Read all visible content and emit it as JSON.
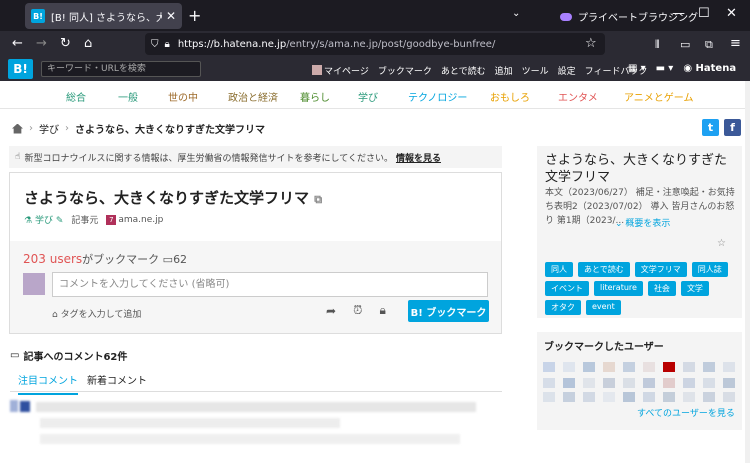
{
  "browser": {
    "tab_title": "[B! 同人] さようなら、大きくなりすぎ",
    "private_label": "プライベートブラウジング",
    "url_host": "https://b.hatena.ne.jp",
    "url_path": "/entry/s/ama.ne.jp/post/goodbye-bunfree/"
  },
  "header": {
    "logo": "B!",
    "search_placeholder": "キーワード・URLを検索",
    "menu": [
      "マイページ",
      "ブックマーク",
      "あとで読む",
      "追加",
      "ツール",
      "設定",
      "フィードバック"
    ],
    "brand": "Hatena"
  },
  "categories": [
    {
      "label": "総合",
      "color": "#2a9a7b"
    },
    {
      "label": "一般",
      "color": "#2a9a7b"
    },
    {
      "label": "世の中",
      "color": "#9d6a2a"
    },
    {
      "label": "政治と経済",
      "color": "#8a6d2e"
    },
    {
      "label": "暮らし",
      "color": "#4a8a2a"
    },
    {
      "label": "学び",
      "color": "#2a9a7b"
    },
    {
      "label": "テクノロジー",
      "color": "#00a4de"
    },
    {
      "label": "おもしろ",
      "color": "#e8a000"
    },
    {
      "label": "エンタメ",
      "color": "#e05454"
    },
    {
      "label": "アニメとゲーム",
      "color": "#e8a000"
    }
  ],
  "breadcrumb": {
    "category": "学び",
    "current": "さようなら、大きくなりすぎた文学フリマ"
  },
  "notice": {
    "text": "新型コロナウイルスに関する情報は、厚生労働省の情報発信サイトを参考にしてください。",
    "link": "情報を見る"
  },
  "entry": {
    "title": "さようなら、大きくなりすぎた文学フリマ",
    "category": "学び",
    "source_label": "記事元",
    "source": "ama.ne.jp",
    "users_count": "203 users",
    "users_suffix": "がブックマーク",
    "comments_count": "62",
    "comment_placeholder": "コメントを入力してください (省略可)",
    "tag_link": "タグを入力して追加",
    "bookmark_button": "B! ブックマーク"
  },
  "comments": {
    "heading": "記事へのコメント62件",
    "tabs": [
      "注目コメント",
      "新着コメント"
    ]
  },
  "sidebar": {
    "title": "さようなら、大きくなりすぎた文学フリマ",
    "summary": "本文（2023/06/27） 補足・注意喚起・お気持ち表明2（2023/07/02） 導入 皆月さんのお怒り 第1期（2023/...",
    "more": "概要を表示",
    "tags": [
      "同人",
      "あとで読む",
      "文学フリマ",
      "同人誌",
      "イベント",
      "literature",
      "社会",
      "文学",
      "オタク",
      "event"
    ],
    "users_title": "ブックマークしたユーザー",
    "users_all": "すべてのユーザーを見る"
  },
  "colors": {
    "brand": "#00a4de",
    "users": "#e05454"
  }
}
